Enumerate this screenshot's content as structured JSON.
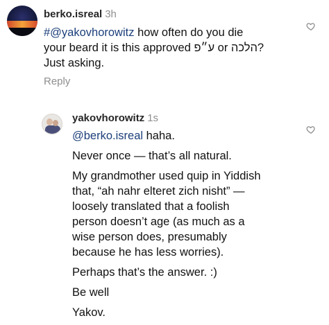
{
  "comment": {
    "username": "berko.isreal",
    "time": "3h",
    "mention": "#@yakovhorowitz",
    "lines": [
      " how often do you die",
      "your beard it is this approved ע״פ or הלכה?",
      "Just asking."
    ],
    "reply_label": "Reply"
  },
  "reply": {
    "username": "yakovhorowitz",
    "time": "1s",
    "mention": "@berko.isreal",
    "first_line_rest": " haha.",
    "paragraphs": [
      "Never once — that’s all natural.",
      "My grandmother used quip in Yiddish",
      "that, “ah nahr elteret zich nisht” —",
      "loosely translated that a foolish",
      "person doesn’t age (as much as a",
      "wise person does, presumably",
      "because he has less worries).",
      "Perhaps that’s the answer. :)",
      "Be well",
      "Yakov."
    ]
  },
  "icons": {
    "like_comment": "heart-outline-icon",
    "like_reply": "heart-outline-icon",
    "icon_color": "#8e8e8e"
  }
}
